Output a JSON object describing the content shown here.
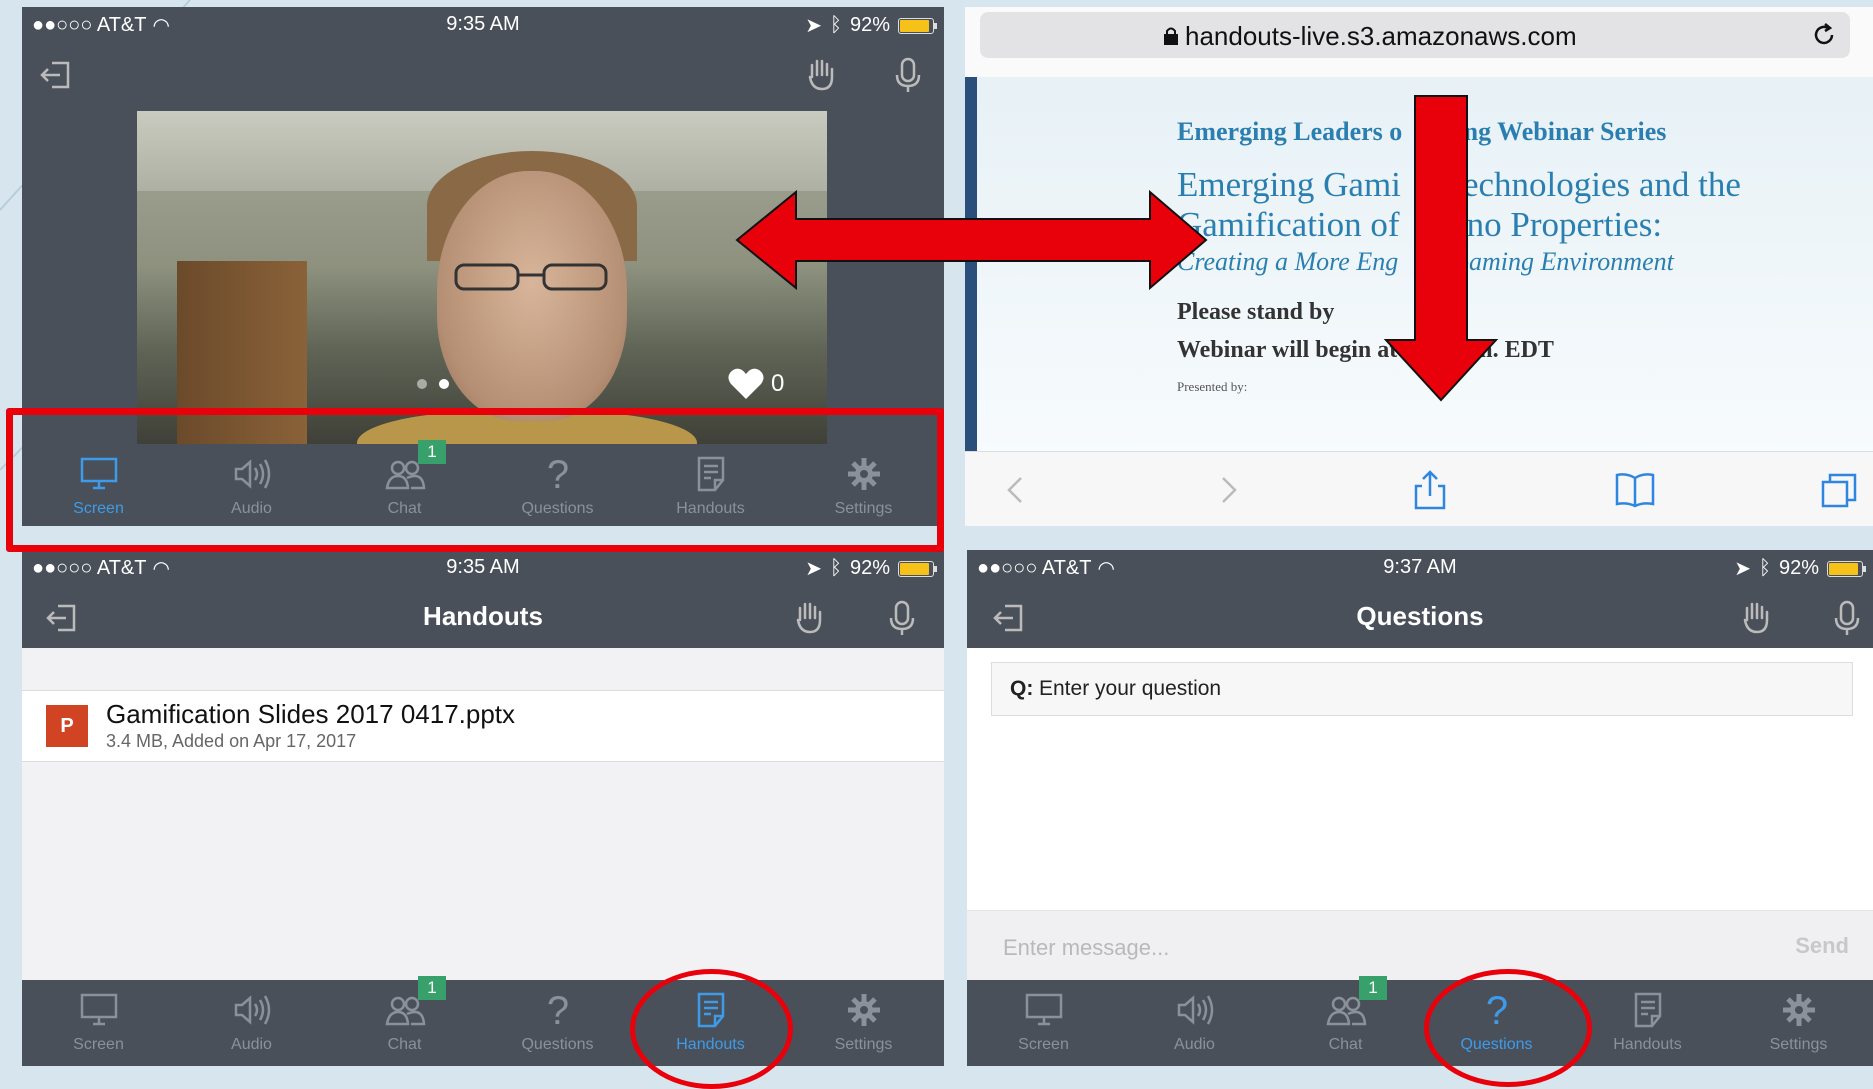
{
  "colors": {
    "accent": "#3d9be9",
    "bar": "#4a505a",
    "badge": "#38a06b",
    "annotation": "#e8000b"
  },
  "status_top": {
    "carrier": "●●○○○ AT&T",
    "time": "9:35 AM",
    "battery": "92%",
    "battery_level": 0.92
  },
  "status_bl": {
    "carrier": "●●○○○ AT&T",
    "time": "9:35 AM",
    "battery": "92%",
    "battery_level": 0.92
  },
  "status_br": {
    "carrier": "●●○○○ AT&T",
    "time": "9:37 AM",
    "battery": "92%",
    "battery_level": 0.92
  },
  "video": {
    "likes": "0",
    "page_dots": 2,
    "active_dot": 2
  },
  "tabs": {
    "screen": "Screen",
    "audio": "Audio",
    "chat": "Chat",
    "questions": "Questions",
    "handouts": "Handouts",
    "settings": "Settings",
    "chat_badge": "1"
  },
  "browser": {
    "url": "handouts-live.s3.amazonaws.com",
    "slide": {
      "series": "Emerging Leaders o     ming Webinar Series",
      "title_l1": "Emerging Gami     Technologies and the",
      "title_l2": "Gamification of     sino Properties:",
      "subtitle": "Creating a More Eng     g Gaming Environment",
      "standby": "Please stand by",
      "begin": "Webinar will begin at 2:00 p.m. EDT",
      "presented": "Presented by:"
    }
  },
  "handouts": {
    "title": "Handouts",
    "file_icon": "P",
    "file_name": "Gamification Slides 2017 0417.pptx",
    "file_meta": "3.4 MB, Added on Apr 17, 2017"
  },
  "questions": {
    "title": "Questions",
    "prefix": "Q:",
    "placeholder": "Enter your question",
    "message_placeholder": "Enter message...",
    "send": "Send"
  }
}
